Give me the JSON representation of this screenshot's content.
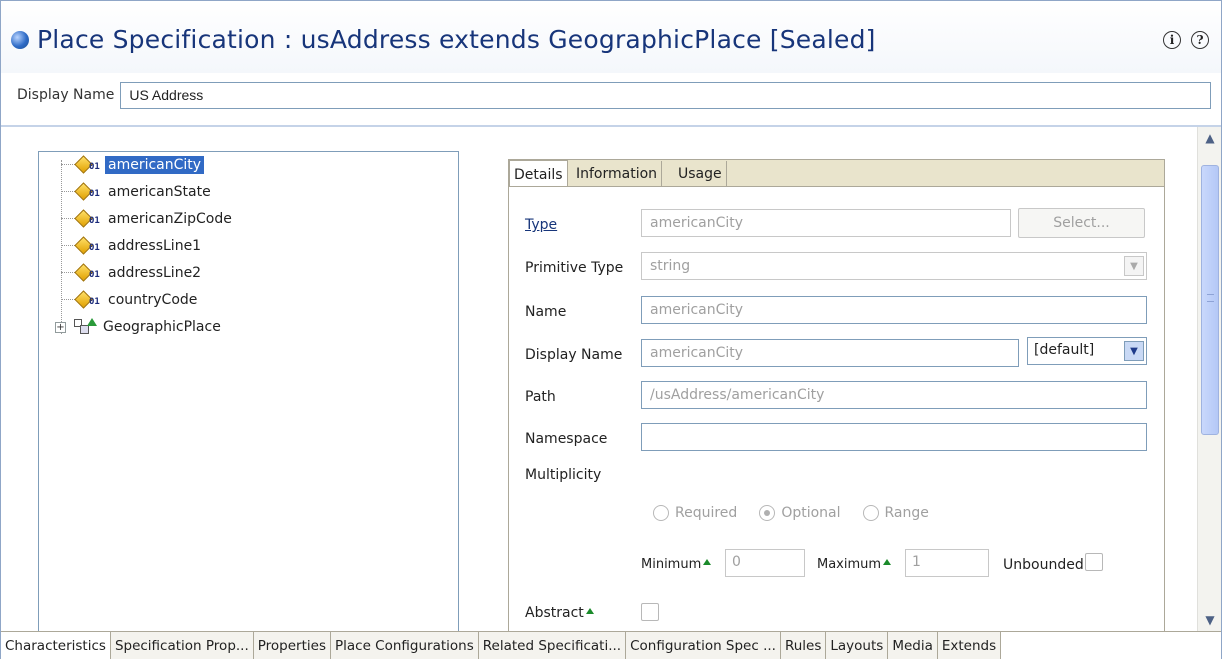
{
  "header": {
    "title": "Place Specification : usAddress extends GeographicPlace [Sealed]",
    "info_icon": "info-icon",
    "help_icon": "help-icon",
    "display_name_label": "Display Name",
    "display_name_value": "US Address"
  },
  "tree": {
    "items": [
      {
        "label": "americanCity",
        "icon": "attribute-icon",
        "selected": true
      },
      {
        "label": "americanState",
        "icon": "attribute-icon"
      },
      {
        "label": "americanZipCode",
        "icon": "attribute-icon"
      },
      {
        "label": "addressLine1",
        "icon": "attribute-icon"
      },
      {
        "label": "addressLine2",
        "icon": "attribute-icon"
      },
      {
        "label": "countryCode",
        "icon": "attribute-icon"
      },
      {
        "label": "GeographicPlace",
        "icon": "class-icon",
        "expander": "+"
      }
    ]
  },
  "details": {
    "tabs": [
      "Details",
      "Information",
      "Usage"
    ],
    "type_label": "Type",
    "type_value": "americanCity",
    "select_button": "Select...",
    "primitive_type_label": "Primitive Type",
    "primitive_type_value": "string",
    "name_label": "Name",
    "name_value": "americanCity",
    "display_name_label": "Display Name",
    "display_name_value": "americanCity",
    "locale_value": "[default]",
    "path_label": "Path",
    "path_value": "/usAddress/americanCity",
    "namespace_label": "Namespace",
    "namespace_value": "",
    "multiplicity_label": "Multiplicity",
    "radio_required": "Required",
    "radio_optional": "Optional",
    "radio_range": "Range",
    "minimum_label": "Minimum",
    "minimum_value": "0",
    "maximum_label": "Maximum",
    "maximum_value": "1",
    "unbounded_label": "Unbounded",
    "abstract_label": "Abstract"
  },
  "bottom_tabs": [
    "Characteristics",
    "Specification Prop...",
    "Properties",
    "Place Configurations",
    "Related Specificati...",
    "Configuration Spec ...",
    "Rules",
    "Layouts",
    "Media",
    "Extends"
  ],
  "colors": {
    "title": "#17357a",
    "selection": "#316ac5",
    "tab_strip": "#e9e4cc"
  }
}
